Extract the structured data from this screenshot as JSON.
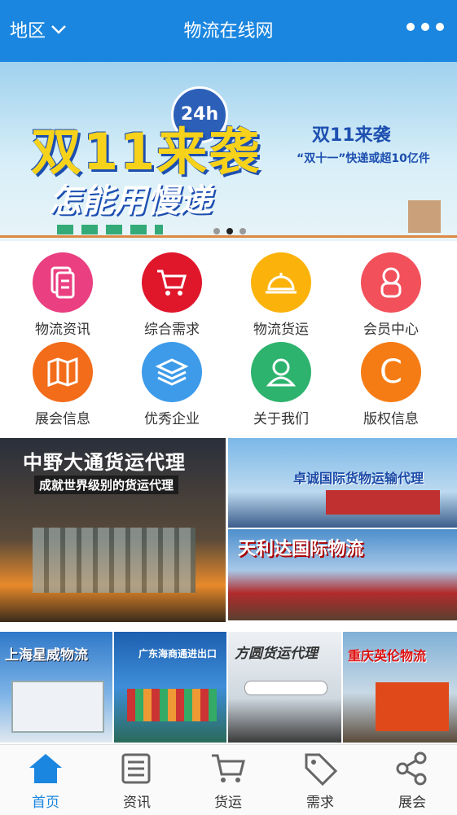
{
  "header": {
    "region_label": "地区",
    "title": "物流在线网",
    "more_icon": "more-dots-icon"
  },
  "banner": {
    "headline": "双11来袭",
    "subline": "怎能用慢递",
    "badge": "24h",
    "small_title": "双11来袭",
    "small_text": "“双十一”快递或超10亿件",
    "slides": 3,
    "active_slide": 2
  },
  "grid": [
    {
      "label": "物流资讯",
      "icon": "document-icon",
      "color": "#ea3f80"
    },
    {
      "label": "综合需求",
      "icon": "cart-icon",
      "color": "#e0162b"
    },
    {
      "label": "物流货运",
      "icon": "service-bell-icon",
      "color": "#fbb30c"
    },
    {
      "label": "会员中心",
      "icon": "member-icon",
      "color": "#f2505a"
    },
    {
      "label": "展会信息",
      "icon": "map-icon",
      "color": "#f26c1a"
    },
    {
      "label": "优秀企业",
      "icon": "layers-icon",
      "color": "#3d9be9"
    },
    {
      "label": "关于我们",
      "icon": "contact-icon",
      "color": "#2db36e"
    },
    {
      "label": "版权信息",
      "icon": "copyright-icon",
      "color": "#f57c14"
    }
  ],
  "ads": {
    "main": {
      "title": "中野大通货运代理",
      "subtitle": "成就世界级别的货运代理"
    },
    "top_right": {
      "title": "卓诚国际货物运输代理"
    },
    "mid_right": {
      "title": "天利达国际物流"
    },
    "bottom": [
      {
        "title": "上海星威物流"
      },
      {
        "title": "广东海商通进出口"
      },
      {
        "title": "方圆货运代理"
      },
      {
        "title": "重庆英伦物流"
      }
    ]
  },
  "nav": [
    {
      "label": "首页",
      "icon": "home-icon",
      "active": true
    },
    {
      "label": "资讯",
      "icon": "newspaper-icon",
      "active": false
    },
    {
      "label": "货运",
      "icon": "cart-icon",
      "active": false
    },
    {
      "label": "需求",
      "icon": "tag-icon",
      "active": false
    },
    {
      "label": "展会",
      "icon": "share-icon",
      "active": false
    }
  ],
  "colors": {
    "accent": "#1a86e0"
  }
}
